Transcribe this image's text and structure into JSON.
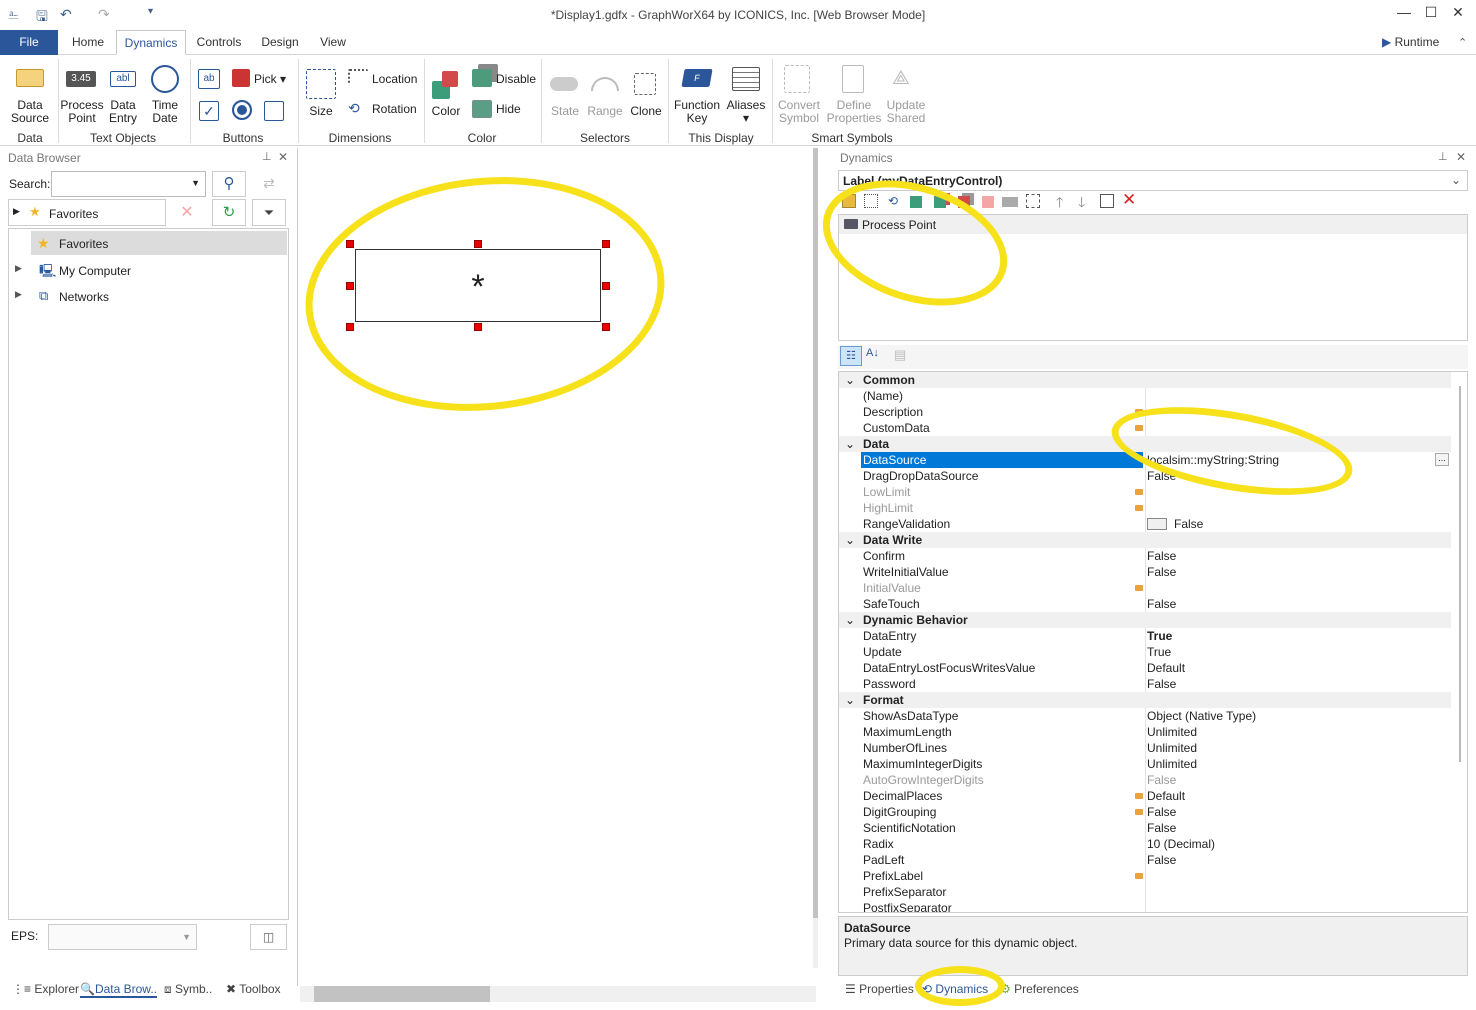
{
  "window": {
    "title": "*Display1.gdfx - GraphWorX64 by ICONICS, Inc. [Web Browser Mode]"
  },
  "tabs": [
    {
      "label": "File"
    },
    {
      "label": "Home"
    },
    {
      "label": "Dynamics"
    },
    {
      "label": "Controls"
    },
    {
      "label": "Design"
    },
    {
      "label": "View"
    }
  ],
  "runtime_label": "Runtime",
  "ribbon": {
    "data_source": "Data Source",
    "process_point": "Process Point",
    "process_point_value": "3.45",
    "data_entry": "Data Entry",
    "data_entry_icon": "abl",
    "time_date": "Time Date",
    "pick": "Pick",
    "size": "Size",
    "location": "Location",
    "rotation": "Rotation",
    "color": "Color",
    "disable": "Disable",
    "hide": "Hide",
    "state": "State",
    "range": "Range",
    "clone": "Clone",
    "function_key": "Function Key",
    "aliases": "Aliases",
    "convert_symbol": "Convert Symbol",
    "define_properties": "Define Properties",
    "update_shared": "Update Shared",
    "groups": {
      "data": "Data",
      "text_objects": "Text Objects",
      "buttons": "Buttons",
      "dimensions": "Dimensions",
      "color": "Color",
      "selectors": "Selectors",
      "this_display": "This Display",
      "smart_symbols": "Smart Symbols"
    }
  },
  "data_browser": {
    "title": "Data Browser",
    "search_label": "Search:",
    "favorites_filter": "Favorites",
    "tree": [
      {
        "label": "Favorites"
      },
      {
        "label": "My Computer"
      },
      {
        "label": "Networks"
      }
    ],
    "eps_label": "EPS:"
  },
  "left_bottom_tabs": [
    {
      "label": "Explorer"
    },
    {
      "label": "Data Brow.."
    },
    {
      "label": "Symb.."
    },
    {
      "label": "Toolbox"
    }
  ],
  "canvas": {
    "control_text": "*"
  },
  "dynamics": {
    "title": "Dynamics",
    "selected_object": "Label (myDataEntryControl)",
    "list": [
      {
        "label": "Process Point"
      }
    ],
    "properties": [
      {
        "type": "cat",
        "name": "Common"
      },
      {
        "name": "(Name)",
        "value": ""
      },
      {
        "name": "Description",
        "value": "",
        "mark": true
      },
      {
        "name": "CustomData",
        "value": "",
        "mark": true
      },
      {
        "type": "cat",
        "name": "Data"
      },
      {
        "name": "DataSource",
        "value": "localsim::myString:String",
        "selected": true
      },
      {
        "name": "DragDropDataSource",
        "value": "False"
      },
      {
        "name": "LowLimit",
        "value": "",
        "mark": true,
        "gray": true
      },
      {
        "name": "HighLimit",
        "value": "",
        "mark": true,
        "gray": true
      },
      {
        "name": "RangeValidation",
        "value": "False",
        "checkbox": true
      },
      {
        "type": "cat",
        "name": "Data Write"
      },
      {
        "name": "Confirm",
        "value": "False"
      },
      {
        "name": "WriteInitialValue",
        "value": "False"
      },
      {
        "name": "InitialValue",
        "value": "",
        "mark": true,
        "gray": true
      },
      {
        "name": "SafeTouch",
        "value": "False"
      },
      {
        "type": "cat",
        "name": "Dynamic Behavior"
      },
      {
        "name": "DataEntry",
        "value": "True",
        "bold": true
      },
      {
        "name": "Update",
        "value": "True"
      },
      {
        "name": "DataEntryLostFocusWritesValue",
        "value": "Default"
      },
      {
        "name": "Password",
        "value": "False"
      },
      {
        "type": "cat",
        "name": "Format"
      },
      {
        "name": "ShowAsDataType",
        "value": "Object (Native Type)"
      },
      {
        "name": "MaximumLength",
        "value": "Unlimited"
      },
      {
        "name": "NumberOfLines",
        "value": "Unlimited"
      },
      {
        "name": "MaximumIntegerDigits",
        "value": "Unlimited"
      },
      {
        "name": "AutoGrowIntegerDigits",
        "value": "False",
        "gray": true
      },
      {
        "name": "DecimalPlaces",
        "value": "Default",
        "mark": true
      },
      {
        "name": "DigitGrouping",
        "value": "False",
        "mark": true
      },
      {
        "name": "ScientificNotation",
        "value": "False"
      },
      {
        "name": "Radix",
        "value": "10 (Decimal)"
      },
      {
        "name": "PadLeft",
        "value": "False"
      },
      {
        "name": "PrefixLabel",
        "value": "",
        "mark": true
      },
      {
        "name": "PrefixSeparator",
        "value": ""
      },
      {
        "name": "PostfixSeparator",
        "value": ""
      }
    ],
    "help_title": "DataSource",
    "help_text": "Primary data source for this dynamic object."
  },
  "right_bottom_tabs": [
    {
      "label": "Properties"
    },
    {
      "label": "Dynamics"
    },
    {
      "label": "Preferences"
    }
  ],
  "colors": {
    "accent": "#2b579a",
    "selection": "#0078d7",
    "annotation": "#f7e11a"
  }
}
